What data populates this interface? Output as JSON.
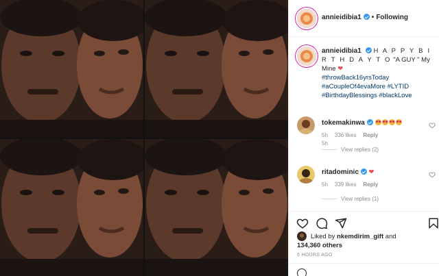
{
  "post": {
    "username": "annieidibia1",
    "follow_status": "Following",
    "separator": "•",
    "caption": {
      "spaced_text": "H A P P Y B I R T H D A Y T O",
      "text_rest": "\"A GUY \" My Mine",
      "hashtags": [
        "#throwBack16yrsToday",
        "#aCoupleOf4evaMore #LYTID",
        "#BirthdayBlessings #blackLove"
      ]
    },
    "time_ago": "5h",
    "likes_user": "nkemdirim_gift",
    "likes_prefix": "Liked by",
    "likes_and": "and",
    "likes_count": "134,360 others",
    "posted": "6 HOURS AGO"
  },
  "comments": [
    {
      "username": "tokemakinwa",
      "time": "5h",
      "likes": "336 likes",
      "reply": "Reply",
      "view_replies": "View replies (2)"
    },
    {
      "username": "ritadominic",
      "time": "5h",
      "likes": "339 likes",
      "reply": "Reply",
      "view_replies": "View replies (1)"
    }
  ],
  "icons": {
    "like": "heart-icon",
    "comment": "comment-icon",
    "share": "share-icon",
    "save": "bookmark-icon",
    "verified": "verified-badge-icon",
    "emoji": "emoji-icon"
  },
  "colors": {
    "verified": "#3897f0",
    "heart": "#ed4956",
    "hashtag": "#00376b",
    "muted": "#8e8e8e"
  }
}
